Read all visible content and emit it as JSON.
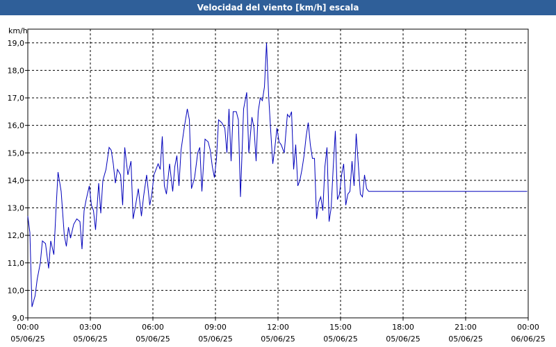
{
  "window": {
    "title": "Velocidad del viento [km/h] escala"
  },
  "chart_data": {
    "type": "line",
    "title": "Velocidad del viento [km/h] escala",
    "ylabel": "km/h",
    "ylim": [
      9.0,
      19.5
    ],
    "yticks": [
      "9,0",
      "10,0",
      "11,0",
      "12,0",
      "13,0",
      "14,0",
      "15,0",
      "16,0",
      "17,0",
      "18,0",
      "19,0"
    ],
    "ytick_values": [
      9,
      10,
      11,
      12,
      13,
      14,
      15,
      16,
      17,
      18,
      19
    ],
    "xlim_hours": [
      0,
      24
    ],
    "xticks": [
      {
        "time": "00:00",
        "date": "05/06/25"
      },
      {
        "time": "03:00",
        "date": "05/06/25"
      },
      {
        "time": "06:00",
        "date": "05/06/25"
      },
      {
        "time": "09:00",
        "date": "05/06/25"
      },
      {
        "time": "12:00",
        "date": "05/06/25"
      },
      {
        "time": "15:00",
        "date": "05/06/25"
      },
      {
        "time": "18:00",
        "date": "05/06/25"
      },
      {
        "time": "21:00",
        "date": "05/06/25"
      },
      {
        "time": "00:00",
        "date": "06/06/25"
      }
    ],
    "grid": true,
    "line_color": "#0000bb",
    "series": [
      {
        "x_hours": [
          0.0,
          0.1,
          0.2,
          0.35,
          0.45,
          0.6,
          0.7,
          0.85,
          1.0,
          1.1,
          1.25,
          1.35,
          1.45,
          1.6,
          1.75,
          1.85,
          1.95,
          2.05,
          2.2,
          2.35,
          2.5,
          2.6,
          2.7,
          2.8,
          2.95,
          3.05,
          3.15,
          3.25,
          3.4,
          3.5,
          3.6,
          3.75,
          3.9,
          4.0,
          4.1,
          4.2,
          4.3,
          4.45,
          4.55,
          4.65,
          4.8,
          4.95,
          5.05,
          5.15,
          5.3,
          5.45,
          5.55,
          5.7,
          5.85,
          5.95,
          6.05,
          6.15,
          6.25,
          6.35,
          6.45,
          6.55,
          6.65,
          6.8,
          6.95,
          7.05,
          7.15,
          7.25,
          7.35,
          7.5,
          7.65,
          7.75,
          7.85,
          8.0,
          8.15,
          8.25,
          8.35,
          8.5,
          8.65,
          8.75,
          8.85,
          8.95,
          9.05,
          9.15,
          9.3,
          9.45,
          9.55,
          9.65,
          9.75,
          9.85,
          10.0,
          10.1,
          10.2,
          10.35,
          10.5,
          10.6,
          10.75,
          10.85,
          10.95,
          11.05,
          11.15,
          11.25,
          11.35,
          11.45,
          11.55,
          11.65,
          11.75,
          11.85,
          11.95,
          12.05,
          12.15,
          12.3,
          12.45,
          12.55,
          12.65,
          12.75,
          12.85,
          12.95,
          13.05,
          13.15,
          13.25,
          13.35,
          13.45,
          13.55,
          13.65,
          13.75,
          13.85,
          13.95,
          14.05,
          14.15,
          14.25,
          14.35,
          14.45,
          14.55,
          14.65,
          14.75,
          14.85,
          14.95,
          15.05,
          15.15,
          15.25,
          15.35,
          15.45,
          15.55,
          15.65,
          15.75,
          15.85,
          15.95,
          16.05,
          16.15,
          16.25,
          16.35,
          16.45,
          16.55,
          16.65,
          16.75,
          16.9,
          17.0,
          17.1,
          17.2,
          17.3,
          17.45,
          17.55,
          17.65,
          17.75,
          17.85,
          17.95,
          18.05,
          18.15,
          18.25,
          18.35,
          18.5,
          18.65,
          18.8,
          18.95,
          19.1,
          19.25,
          19.4,
          19.5,
          19.6,
          19.7,
          19.85,
          19.95,
          20.05,
          20.15,
          20.25,
          20.35,
          20.45,
          20.55,
          20.65,
          20.75,
          20.85,
          20.95,
          21.05,
          21.15,
          21.25,
          21.35,
          21.45,
          21.55,
          21.65,
          21.75,
          21.85,
          21.95,
          22.05,
          22.15,
          22.3,
          22.45,
          22.55,
          22.65,
          22.75,
          22.85,
          22.95,
          23.05,
          23.15,
          23.25,
          23.35,
          23.45,
          23.55,
          23.65,
          23.75,
          23.85,
          23.95
        ],
        "values": [
          12.7,
          12.1,
          9.4,
          9.8,
          10.4,
          11.0,
          11.8,
          11.7,
          10.8,
          11.8,
          11.3,
          12.9,
          14.3,
          13.6,
          12.0,
          11.6,
          12.3,
          11.9,
          12.4,
          12.6,
          12.5,
          11.5,
          12.9,
          13.3,
          13.8,
          13.1,
          12.9,
          12.2,
          13.9,
          12.8,
          14.0,
          14.4,
          15.2,
          15.1,
          14.6,
          13.9,
          14.4,
          14.2,
          13.1,
          15.2,
          14.2,
          14.7,
          12.6,
          13.0,
          13.7,
          12.7,
          13.4,
          14.2,
          13.1,
          13.5,
          14.2,
          14.4,
          14.6,
          14.4,
          15.6,
          13.8,
          13.5,
          14.6,
          13.6,
          14.5,
          14.9,
          13.8,
          15.1,
          15.9,
          16.6,
          16.2,
          13.7,
          14.1,
          15.0,
          15.2,
          13.6,
          15.5,
          15.4,
          15.1,
          14.5,
          14.1,
          14.8,
          16.2,
          16.1,
          15.9,
          15.0,
          16.6,
          14.7,
          16.5,
          16.5,
          16.2,
          13.4,
          16.6,
          17.2,
          15.0,
          16.3,
          15.9,
          14.7,
          16.5,
          17.0,
          16.9,
          17.4,
          19.0,
          17.1,
          15.8,
          14.6,
          15.2,
          15.9,
          15.4,
          15.3,
          15.0,
          16.4,
          16.3,
          16.5,
          14.4,
          15.3,
          13.8,
          14.0,
          14.4,
          14.9,
          15.6,
          16.1,
          15.3,
          14.8,
          14.8,
          12.6,
          13.2,
          13.4,
          12.9,
          14.5,
          15.2,
          12.5,
          13.0,
          14.5,
          15.8,
          13.3,
          13.5,
          14.2,
          14.6,
          13.1,
          13.5,
          13.6,
          14.7,
          13.8,
          15.7,
          14.6,
          13.5,
          13.4,
          14.2,
          13.7,
          13.6,
          13.6,
          13.6,
          13.6,
          13.6,
          13.6,
          13.6,
          13.6,
          13.6,
          13.6,
          13.6,
          13.6,
          13.6,
          13.6,
          13.6,
          13.6,
          13.6,
          13.6,
          13.6,
          13.6,
          13.6,
          13.6,
          13.6,
          13.6,
          13.6,
          13.6,
          13.6,
          13.6,
          13.6,
          13.6,
          13.6,
          13.6,
          13.6,
          13.6,
          13.6,
          13.6,
          13.6,
          13.6,
          13.6,
          13.6,
          13.6,
          13.6,
          13.6,
          13.6,
          13.6,
          13.6,
          13.6,
          13.6,
          13.6,
          13.6,
          13.6,
          13.6,
          13.6,
          13.6,
          13.6,
          13.6,
          13.6,
          13.6,
          13.6,
          13.6,
          13.6,
          13.6,
          13.6,
          13.6,
          13.6,
          13.6,
          13.6,
          13.6,
          13.6,
          13.6,
          13.6,
          13.6,
          13.6
        ]
      }
    ]
  }
}
